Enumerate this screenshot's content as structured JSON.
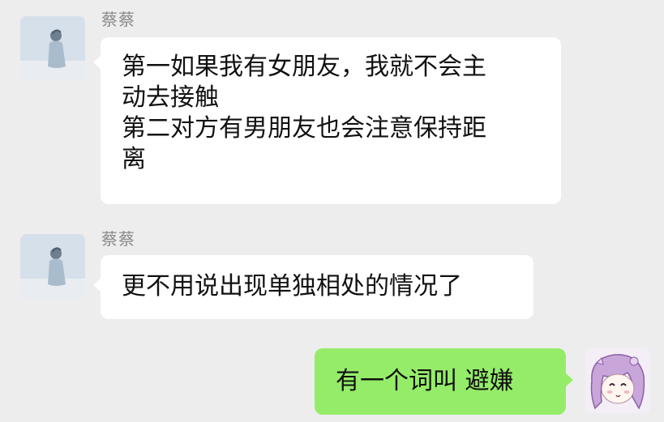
{
  "chat": {
    "messages": [
      {
        "sender": "蔡蔡",
        "lines": [
          "第一如果我有女朋友，我就不会主",
          "动去接触",
          "第二对方有男朋友也会注意保持距",
          "离"
        ]
      },
      {
        "sender": "蔡蔡",
        "lines": [
          "更不用说出现单独相处的情况了"
        ]
      },
      {
        "sender": "",
        "lines": [
          "有一个词叫  避嫌"
        ]
      }
    ]
  },
  "colors": {
    "background": "#ededed",
    "incoming_bubble": "#ffffff",
    "outgoing_bubble": "#95ec69",
    "sender_name": "#8a8a8a"
  },
  "icons": {
    "contact_avatar": "person-photo-avatar-icon",
    "self_avatar": "anime-girl-avatar-icon"
  }
}
